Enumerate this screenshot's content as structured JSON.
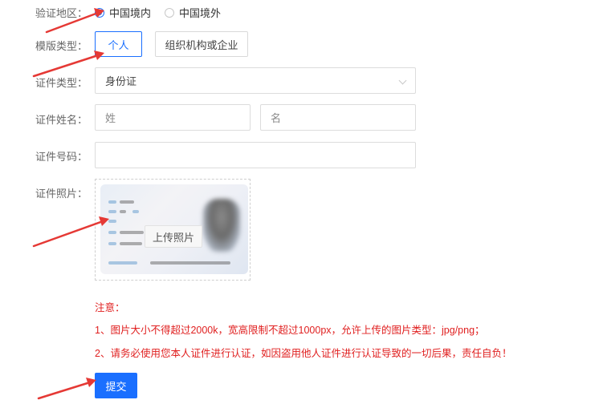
{
  "region": {
    "label": "验证地区：",
    "options": [
      {
        "text": "中国境内",
        "checked": true
      },
      {
        "text": "中国境外",
        "checked": false
      }
    ]
  },
  "template_type": {
    "label": "模版类型：",
    "options": [
      {
        "text": "个人",
        "active": true
      },
      {
        "text": "组织机构或企业",
        "active": false
      }
    ]
  },
  "id_type": {
    "label": "证件类型：",
    "value": "身份证"
  },
  "id_name": {
    "label": "证件姓名：",
    "surname_placeholder": "姓",
    "given_placeholder": "名"
  },
  "id_number": {
    "label": "证件号码：",
    "value": ""
  },
  "id_photo": {
    "label": "证件照片：",
    "upload_label": "上传照片"
  },
  "notes": {
    "title": "注意：",
    "items": [
      "1、图片大小不得超过2000k，宽高限制不超过1000px，允许上传的图片类型：jpg/png；",
      "2、请务必使用您本人证件进行认证，如因盗用他人证件进行认证导致的一切后果，责任自负！"
    ]
  },
  "submit_label": "提交",
  "colors": {
    "accent": "#1a6fff",
    "warning": "#e02020",
    "arrow": "#e53935"
  }
}
